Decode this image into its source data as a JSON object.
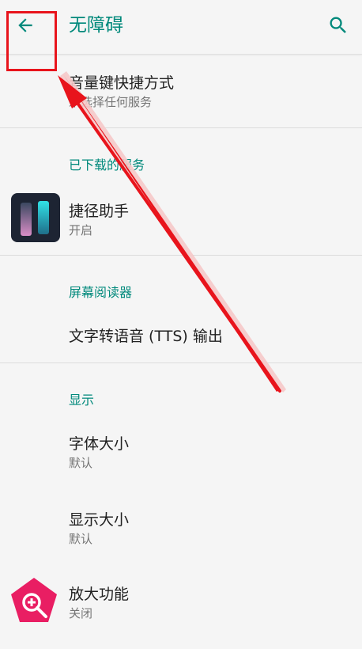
{
  "appbar": {
    "title": "无障碍"
  },
  "items": {
    "volume_shortcut": {
      "title": "音量键快捷方式",
      "subtitle": "未选择任何服务"
    },
    "shortcut_assistant": {
      "title": "捷径助手",
      "subtitle": "开启"
    },
    "tts_output": {
      "title": "文字转语音 (TTS) 输出"
    },
    "font_size": {
      "title": "字体大小",
      "subtitle": "默认"
    },
    "display_size": {
      "title": "显示大小",
      "subtitle": "默认"
    },
    "magnification": {
      "title": "放大功能",
      "subtitle": "关闭"
    }
  },
  "sections": {
    "downloaded_services": "已下载的服务",
    "screen_readers": "屏幕阅读器",
    "display": "显示"
  },
  "icons": {
    "back": "arrow-left-icon",
    "search": "search-icon",
    "shortcut_app": "shortcut-assistant-icon",
    "magnification": "magnify-plus-icon"
  },
  "colors": {
    "accent": "#00897b",
    "annotation": "#e8141c",
    "magnify_icon": "#e91e63"
  }
}
